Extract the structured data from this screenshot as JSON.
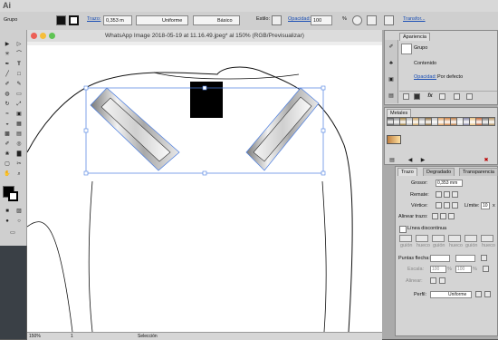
{
  "app": {
    "logo": "Ai"
  },
  "control_bar": {
    "selection_label": "Grupo",
    "stroke_label": "Trazo:",
    "stroke_weight": "0,353 m",
    "profile": "Uniforme",
    "brush": "Básico",
    "style_label": "Estilo:",
    "opacity_label": "Opacidad:",
    "opacity_value": "100",
    "percent": "%",
    "transform_label": "Transfor..."
  },
  "document": {
    "title": "WhatsApp Image 2018-05-19 at 11.16.49.jpeg* al 150% (RGB/Previsualizar)",
    "zoom": "150%",
    "page": "1",
    "status": "Selección"
  },
  "appearance_panel": {
    "tab": "Apariencia",
    "object": "Grupo",
    "contents": "Contenido",
    "opacity_label": "Opacidad:",
    "opacity_value": "Por defecto"
  },
  "swatch_panel": {
    "tab": "Metales",
    "colors": [
      "#555555",
      "#888888",
      "#9a7a3a",
      "#b0b0b0",
      "#c8a060",
      "#a0a0a0",
      "#8a6a3a",
      "#c0c0c0",
      "#e0a060",
      "#d08040",
      "#b87840",
      "#d0d0d0",
      "#8080a0",
      "#e8c080",
      "#c06030",
      "#707070",
      "#b09060"
    ]
  },
  "stroke_panel": {
    "tabs": [
      "Trazo",
      "Degradado",
      "Transparencia"
    ],
    "weight_label": "Grosor:",
    "weight_value": "0,353 mm",
    "cap_label": "Remate:",
    "corner_label": "Vértice:",
    "limit_label": "Límite:",
    "limit_value": "10",
    "limit_unit": "x",
    "align_label": "Alinear trazo:",
    "dashed_label": "Línea discontinua",
    "dash_headers": [
      "guión",
      "hueco",
      "guión",
      "hueco",
      "guión",
      "hueco"
    ],
    "arrow_label": "Puntas flecha:",
    "scale_label": "Escala:",
    "scale_value_1": "100",
    "scale_value_2": "100",
    "scale_unit": "%",
    "align2_label": "Alinear:",
    "profile_label": "Perfil:",
    "profile_value": "Uniforme"
  }
}
